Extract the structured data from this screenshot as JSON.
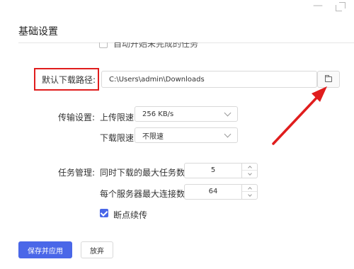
{
  "window": {
    "minimize_glyph": "—",
    "title": "基础设置"
  },
  "clipped_option": {
    "label": "自动开始未完成的任务"
  },
  "download_path": {
    "label": "默认下载路径:",
    "value": "C:\\Users\\admin\\Downloads",
    "browse_icon": "folder-icon"
  },
  "transfer": {
    "section_label": "传输设置:",
    "upload_label": "上传限速",
    "upload_value": "256 KB/s",
    "download_label": "下载限速",
    "download_value": "不限速"
  },
  "tasks": {
    "section_label": "任务管理:",
    "max_tasks_label": "同时下载的最大任务数",
    "max_tasks_value": "5",
    "max_conn_label": "每个服务器最大连接数",
    "max_conn_value": "64",
    "resume_label": "断点续传",
    "resume_checked": true
  },
  "actions": {
    "save_label": "保存并应用",
    "cancel_label": "放弃"
  },
  "colors": {
    "accent": "#4a67e8",
    "highlight": "#e01d1d"
  }
}
